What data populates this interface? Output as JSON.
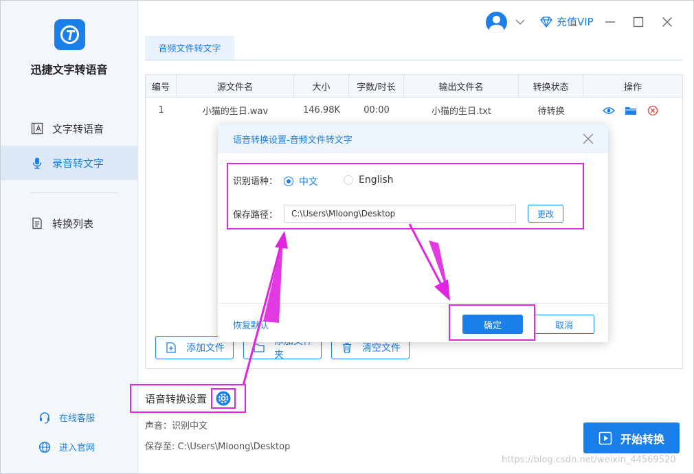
{
  "app": {
    "name": "迅捷文字转语音"
  },
  "sidebar": {
    "items": [
      {
        "label": "文字转语音",
        "icon": "text-doc-icon"
      },
      {
        "label": "录音转文字",
        "icon": "microphone-icon"
      },
      {
        "label": "转换列表",
        "icon": "list-icon"
      }
    ],
    "links": [
      {
        "label": "在线客服",
        "icon": "headset-icon"
      },
      {
        "label": "进入官网",
        "icon": "globe-icon"
      }
    ]
  },
  "titlebar": {
    "vip_label": "充值VIP"
  },
  "tab": {
    "label": "音频文件转文字"
  },
  "table": {
    "headers": [
      "编号",
      "源文件名",
      "大小",
      "字数/时长",
      "输出文件名",
      "转换状态",
      "操作"
    ],
    "rows": [
      {
        "index": "1",
        "source": "小猫的生日.wav",
        "size": "146.98K",
        "duration": "00:00",
        "output": "小猫的生日.txt",
        "status": "待转换"
      }
    ]
  },
  "actions": {
    "add_file": "添加文件",
    "add_folder": "添加文件夹",
    "clear": "清空文件"
  },
  "settings": {
    "title": "语音转换设置",
    "voice": "声音：识别中文",
    "save_to": "保存至: C:\\Users\\Mloong\\Desktop"
  },
  "start_button": "开始转换",
  "modal": {
    "title": "语音转换设置-音频文件转文字",
    "lang_label": "识别语种：",
    "options": [
      "中文",
      "English"
    ],
    "selected": "中文",
    "path_label": "保存路径：",
    "path_value": "C:\\Users\\Mloong\\Desktop",
    "change_label": "更改",
    "restore_label": "恢复默认",
    "ok_label": "确定",
    "cancel_label": "取消"
  },
  "watermark": "https://blog.csdn.net/weixin_44569520",
  "colors": {
    "accent": "#1a7fe8",
    "highlight": "#e024e0",
    "danger": "#e53935"
  }
}
